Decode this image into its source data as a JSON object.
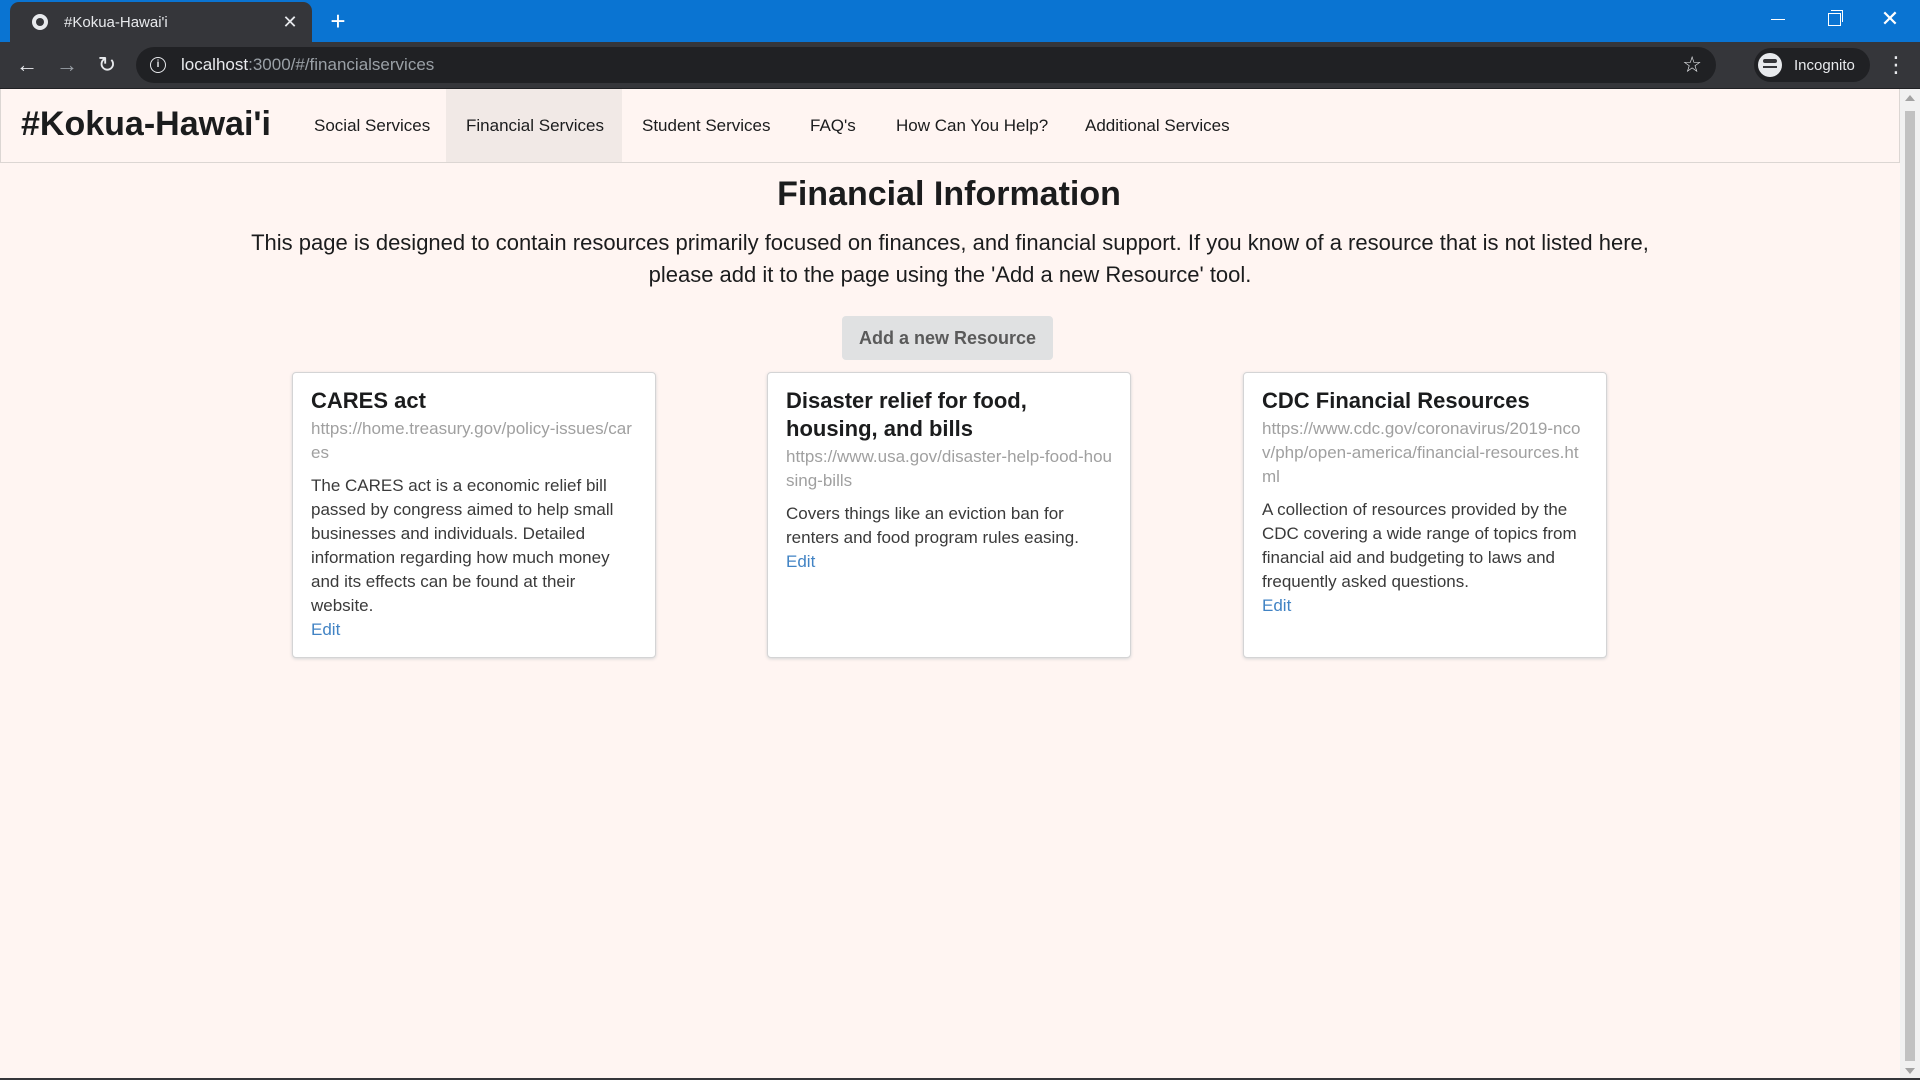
{
  "browser": {
    "tab_title": "#Kokua-Hawai'i",
    "url_host": "localhost",
    "url_path": ":3000/#/financialservices",
    "profile_label": "Incognito",
    "icons": {
      "favicon": "app-favicon",
      "tab_close": "close-icon",
      "new_tab": "plus-icon",
      "back": "arrow-left-icon",
      "forward": "arrow-right-icon",
      "reload": "reload-icon",
      "site_info": "info-icon",
      "bookmark": "star-icon",
      "incognito": "incognito-icon",
      "menu": "kebab-menu-icon",
      "minimize": "minimize-icon",
      "maximize": "restore-icon",
      "close": "window-close-icon"
    },
    "colors": {
      "titlebar": "#0a74d2",
      "toolbar": "#35363a"
    }
  },
  "site": {
    "brand": "#Kokua-Hawai'i",
    "nav": [
      {
        "label": "Social Services",
        "active": false
      },
      {
        "label": "Financial Services",
        "active": true
      },
      {
        "label": "Student Services",
        "active": false
      },
      {
        "label": "FAQ's",
        "active": false
      },
      {
        "label": "How Can You Help?",
        "active": false
      },
      {
        "label": "Additional Services",
        "active": false
      }
    ]
  },
  "main": {
    "title": "Financial Information",
    "description": "This page is designed to contain resources primarily focused on finances, and financial support. If you know of a resource that is not listed here, please add it to the page using the 'Add a new Resource' tool.",
    "add_button": "Add a new Resource",
    "cards": [
      {
        "title": "CARES act",
        "url": "https://home.treasury.gov/policy-issues/cares",
        "description": "The CARES act is a economic relief bill passed by congress aimed to help small businesses and individuals. Detailed information regarding how much money and its effects can be found at their website.",
        "edit": "Edit"
      },
      {
        "title": "Disaster relief for food, housing, and bills",
        "url": "https://www.usa.gov/disaster-help-food-housing-bills",
        "description": "Covers things like an eviction ban for renters and food program rules easing.",
        "edit": "Edit"
      },
      {
        "title": "CDC Financial Resources",
        "url": "https://www.cdc.gov/coronavirus/2019-ncov/php/open-america/financial-resources.html",
        "description": "A collection of resources provided by the CDC covering a wide range of topics from financial aid and budgeting to laws and frequently asked questions.",
        "edit": "Edit"
      }
    ],
    "colors": {
      "background": "#fff5f2",
      "link": "#4183c4",
      "button": "#e0e1e2"
    }
  }
}
